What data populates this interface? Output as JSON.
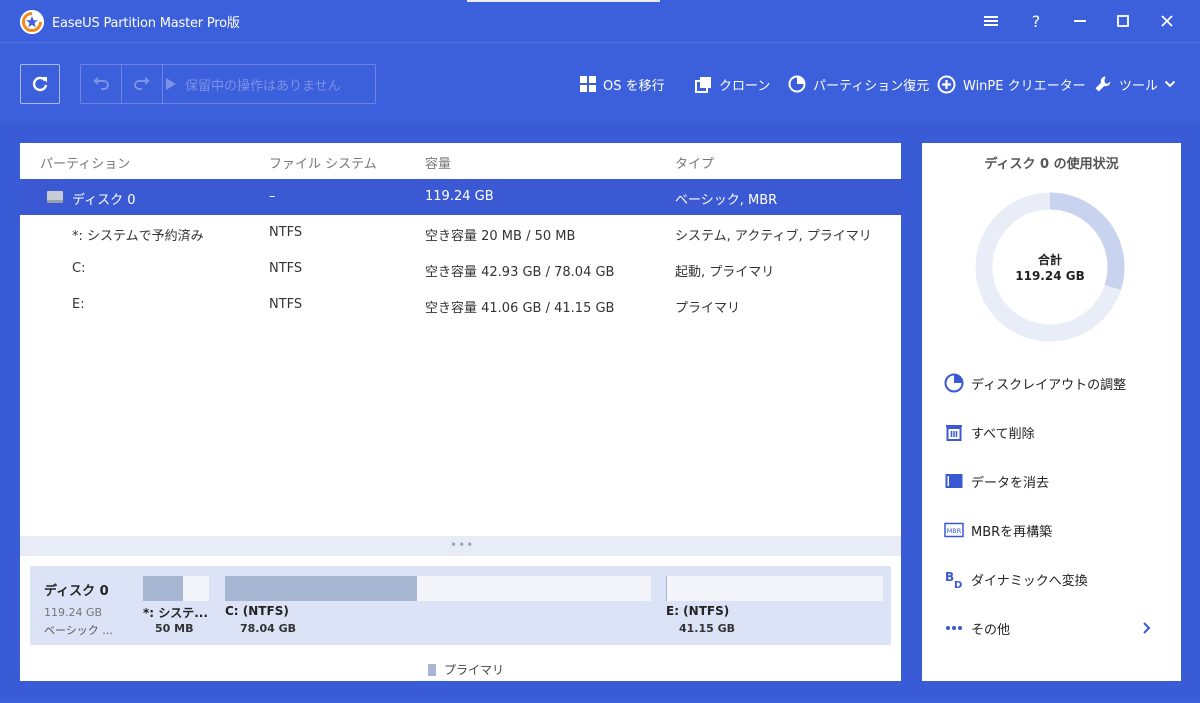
{
  "window": {
    "title": "EaseUS Partition Master Pro版",
    "controls": [
      "menu-icon",
      "help-icon",
      "minimize-icon",
      "maximize-icon",
      "close-icon"
    ]
  },
  "toolbar": {
    "pending_label": "保留中の操作はありません",
    "tools": [
      {
        "label": "OS を移行",
        "icon": "windows-icon"
      },
      {
        "label": "クローン",
        "icon": "clone-icon"
      },
      {
        "label": "パーティション復元",
        "icon": "pie-icon"
      },
      {
        "label": "WinPE クリエーター",
        "icon": "plus-circle-icon"
      },
      {
        "label": "ツール",
        "icon": "wrench-icon"
      }
    ]
  },
  "table": {
    "headers": [
      "パーティション",
      "ファイル システム",
      "容量",
      "タイプ"
    ],
    "rows": [
      {
        "name": "ディスク 0",
        "fs": "–",
        "capacity": "119.24 GB",
        "type": "ベーシック, MBR",
        "selected": true
      },
      {
        "name": "*: システムで予約済み",
        "fs": "NTFS",
        "capacity": "空き容量 20 MB / 50 MB",
        "type": "システム, アクティブ, プライマリ"
      },
      {
        "name": "C:",
        "fs": "NTFS",
        "capacity": "空き容量 42.93 GB / 78.04 GB",
        "type": "起動, プライマリ"
      },
      {
        "name": "E:",
        "fs": "NTFS",
        "capacity": "空き容量 41.06 GB / 41.15 GB",
        "type": "プライマリ"
      }
    ]
  },
  "disk_map": {
    "name": "ディスク 0",
    "size": "119.24 GB",
    "type": "ベーシック ...",
    "partitions": [
      {
        "label": "*: システ...",
        "size": "50 MB",
        "used_fraction": 0.6
      },
      {
        "label": "C: (NTFS)",
        "size": "78.04 GB",
        "used_fraction": 0.45
      },
      {
        "label": "E: (NTFS)",
        "size": "41.15 GB",
        "used_fraction": 0.002
      }
    ],
    "legend": "プライマリ"
  },
  "usage": {
    "title": "ディスク 0 の使用状況",
    "total_label": "合計",
    "total_value": "119.24 GB",
    "used_fraction": 0.3,
    "colors": {
      "used": "#c7d3ef",
      "free": "#e8edf8"
    }
  },
  "actions": [
    {
      "label": "ディスクレイアウトの調整",
      "icon": "pie-icon"
    },
    {
      "label": "すべて削除",
      "icon": "trash-icon"
    },
    {
      "label": "データを消去",
      "icon": "eraser-icon"
    },
    {
      "label": "MBRを再構築",
      "icon": "mbr-icon"
    },
    {
      "label": "ダイナミックへ変換",
      "icon": "dynamic-icon"
    },
    {
      "label": "その他",
      "icon": "more-icon"
    }
  ]
}
